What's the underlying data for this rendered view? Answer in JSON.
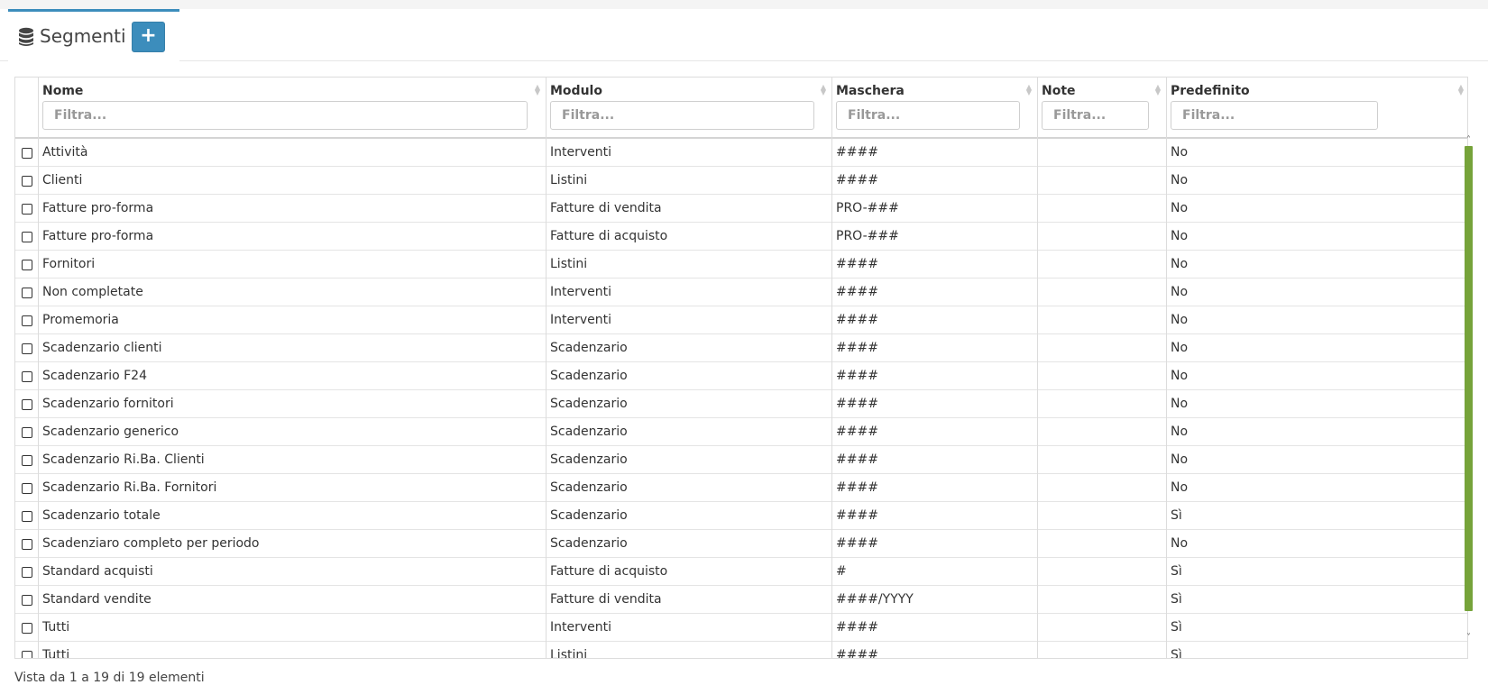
{
  "tab": {
    "title": "Segmenti",
    "add_label": "+",
    "icon": "database-icon"
  },
  "table": {
    "columns": [
      {
        "key": "nome",
        "label": "Nome",
        "placeholder": "Filtra..."
      },
      {
        "key": "modulo",
        "label": "Modulo",
        "placeholder": "Filtra..."
      },
      {
        "key": "maschera",
        "label": "Maschera",
        "placeholder": "Filtra..."
      },
      {
        "key": "note",
        "label": "Note",
        "placeholder": "Filtra..."
      },
      {
        "key": "predefinito",
        "label": "Predefinito",
        "placeholder": "Filtra..."
      }
    ],
    "rows": [
      [
        "Attività",
        "Interventi",
        "####",
        "",
        "No"
      ],
      [
        "Clienti",
        "Listini",
        "####",
        "",
        "No"
      ],
      [
        "Fatture pro-forma",
        "Fatture di vendita",
        "PRO-###",
        "",
        "No"
      ],
      [
        "Fatture pro-forma",
        "Fatture di acquisto",
        "PRO-###",
        "",
        "No"
      ],
      [
        "Fornitori",
        "Listini",
        "####",
        "",
        "No"
      ],
      [
        "Non completate",
        "Interventi",
        "####",
        "",
        "No"
      ],
      [
        "Promemoria",
        "Interventi",
        "####",
        "",
        "No"
      ],
      [
        "Scadenzario clienti",
        "Scadenzario",
        "####",
        "",
        "No"
      ],
      [
        "Scadenzario F24",
        "Scadenzario",
        "####",
        "",
        "No"
      ],
      [
        "Scadenzario fornitori",
        "Scadenzario",
        "####",
        "",
        "No"
      ],
      [
        "Scadenzario generico",
        "Scadenzario",
        "####",
        "",
        "No"
      ],
      [
        "Scadenzario Ri.Ba. Clienti",
        "Scadenzario",
        "####",
        "",
        "No"
      ],
      [
        "Scadenzario Ri.Ba. Fornitori",
        "Scadenzario",
        "####",
        "",
        "No"
      ],
      [
        "Scadenzario totale",
        "Scadenzario",
        "####",
        "",
        "Sì"
      ],
      [
        "Scadenziaro completo per periodo",
        "Scadenzario",
        "####",
        "",
        "No"
      ],
      [
        "Standard acquisti",
        "Fatture di acquisto",
        "#",
        "",
        "Sì"
      ],
      [
        "Standard vendite",
        "Fatture di vendita",
        "####/YYYY",
        "",
        "Sì"
      ],
      [
        "Tutti",
        "Interventi",
        "####",
        "",
        "Sì"
      ],
      [
        "Tutti",
        "Listini",
        "####",
        "",
        "Sì"
      ]
    ]
  },
  "footer": {
    "text": "Vista da 1 a 19 di 19 elementi"
  },
  "colors": {
    "accent": "#3c8dbc",
    "scrollbar": "#76a33a"
  }
}
